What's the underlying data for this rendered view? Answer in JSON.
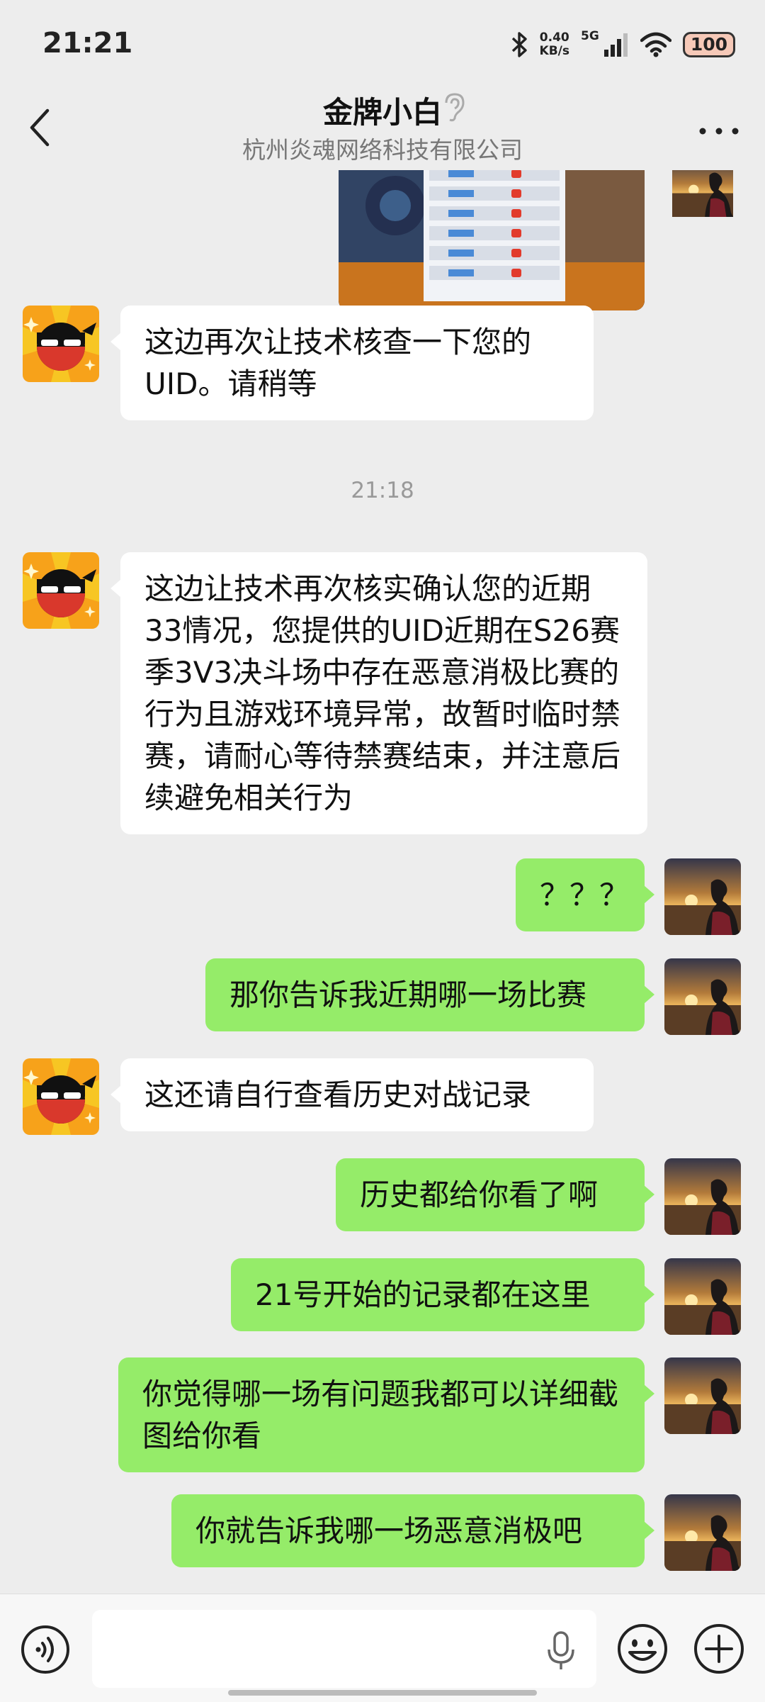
{
  "status_bar": {
    "time": "21:21",
    "net_speed_value": "0.40",
    "net_speed_unit": "KB/s",
    "network_type": "5G",
    "battery": "100"
  },
  "header": {
    "title": "金牌小白",
    "subtitle": "杭州炎魂网络科技有限公司"
  },
  "chat": {
    "timestamp": "21:18",
    "messages": [
      {
        "side": "left",
        "text": "这边再次让技术核查一下您的UID。请稍等"
      },
      {
        "side": "left",
        "text": "这边让技术再次核实确认您的近期33情况，您提供的UID近期在S26赛季3V3决斗场中存在恶意消极比赛的行为且游戏环境异常，故暂时临时禁赛，请耐心等待禁赛结束，并注意后续避免相关行为"
      },
      {
        "side": "right",
        "text": "？？？"
      },
      {
        "side": "right",
        "text": "那你告诉我近期哪一场比赛"
      },
      {
        "side": "left",
        "text": "这还请自行查看历史对战记录"
      },
      {
        "side": "right",
        "text": "历史都给你看了啊"
      },
      {
        "side": "right",
        "text": "21号开始的记录都在这里"
      },
      {
        "side": "right",
        "text": "你觉得哪一场有问题我都可以详细截图给你看"
      },
      {
        "side": "right",
        "text": "你就告诉我哪一场恶意消极吧"
      }
    ]
  },
  "icons": {
    "back": "chevron-left-icon",
    "ear": "ear-icon",
    "more": "more-dots-icon",
    "voice": "voice-icon",
    "mic": "microphone-icon",
    "emoji": "emoji-icon",
    "plus": "plus-icon"
  },
  "colors": {
    "background": "#ededed",
    "self_bubble": "#95ec69",
    "other_bubble": "#ffffff",
    "bottom_bar": "#f7f7f7"
  }
}
